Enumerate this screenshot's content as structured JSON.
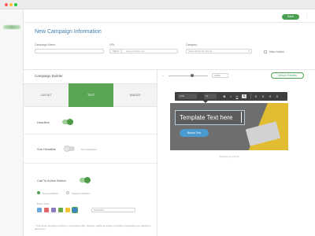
{
  "topbar": {
    "save_label": "Save",
    "menu_icon": "kebab-menu-icon"
  },
  "page_title": "New Campaign Information",
  "form": {
    "name_label": "Campaign Name",
    "url_label": "URL",
    "protocol_value": "http://",
    "url_placeholder": "www.yoursite.com",
    "category_label": "Category",
    "category_value": "Select Relevant Group",
    "checkbox_label": "Make Default"
  },
  "builder": {
    "title": "Campaign Builder",
    "tabs": [
      "LAYOUT",
      "TEXT",
      "IMAGES"
    ],
    "active_tab": "TEXT",
    "headline_label": "Headline",
    "subheadline_label": "Sub Headline",
    "subheadline_hint": "No Subheadline",
    "cta_label": "Call To Action Button",
    "radio_rounded": "Rounded Button",
    "radio_square": "Squared off Button",
    "color_label": "Button Color",
    "swatches": [
      "#6fa8dc",
      "#e06666",
      "#8e7cc3",
      "#6aa84f",
      "#f1c232",
      "#3d85c6"
    ],
    "hex_value": "#4A9AD0",
    "note": "* Your whole campaign is a link to your desired URL, however, adding an image or a button encourages your viewers to take action."
  },
  "preview": {
    "zoom": "100%",
    "preview_button": "Device Preview",
    "font_select": "Arial",
    "size_select": "14",
    "toolbar_buttons": [
      "B",
      "I",
      "U",
      "A"
    ],
    "template_text": "Template Text here",
    "cta_text": "Button Text",
    "caption": "Showing all with 5s"
  },
  "colors": {
    "accent": "#4aa050",
    "blue": "#3f7fb0"
  }
}
